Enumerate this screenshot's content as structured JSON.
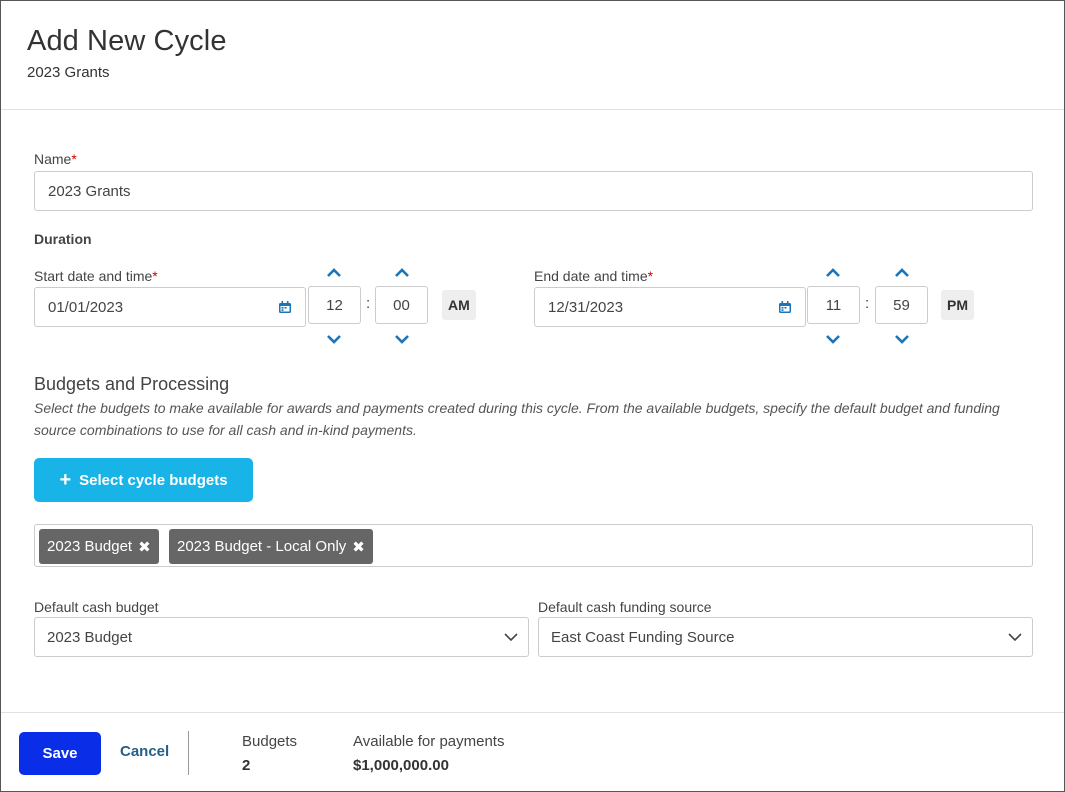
{
  "header": {
    "title": "Add New Cycle",
    "subtitle": "2023 Grants"
  },
  "form": {
    "name": {
      "label": "Name",
      "required_mark": "*",
      "value": "2023 Grants"
    },
    "duration": {
      "heading": "Duration",
      "start": {
        "label": "Start date and time",
        "required_mark": "*",
        "date": "01/01/2023",
        "hour": "12",
        "minute": "00",
        "separator": ":",
        "meridiem": "AM"
      },
      "end": {
        "label": "End date and time",
        "required_mark": "*",
        "date": "12/31/2023",
        "hour": "11",
        "minute": "59",
        "separator": ":",
        "meridiem": "PM"
      }
    },
    "budgets": {
      "heading": "Budgets and Processing",
      "help": "Select the budgets to make available for awards and payments created during this cycle. From the available budgets, specify the default budget and funding source combinations to use for all cash and in-kind payments.",
      "select_button": {
        "icon": "plus-icon",
        "label": "Select cycle budgets"
      },
      "tags": [
        {
          "label": "2023 Budget",
          "remove": "✖"
        },
        {
          "label": "2023 Budget - Local Only",
          "remove": "✖"
        }
      ],
      "default_cash_budget": {
        "label": "Default cash budget",
        "value": "2023 Budget"
      },
      "default_cash_funding_source": {
        "label": "Default cash funding source",
        "value": "East Coast Funding Source"
      }
    }
  },
  "footer": {
    "save_label": "Save",
    "cancel_label": "Cancel",
    "budgets_label": "Budgets",
    "budgets_value": "2",
    "available_label": "Available for payments",
    "available_value": "$1,000,000.00"
  },
  "colors": {
    "primary_button": "#18b4e8",
    "save_button": "#0a2ee8",
    "link": "#245f8a",
    "icon_accent": "#1a75b8",
    "tag_bg": "#666666",
    "required": "#cc0000"
  }
}
